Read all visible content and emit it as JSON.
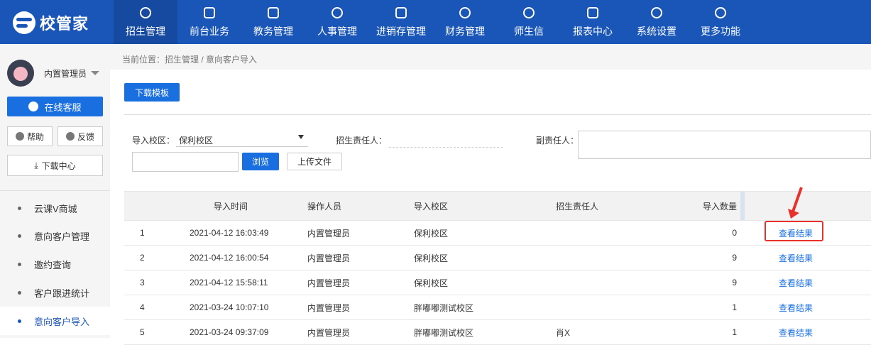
{
  "app": {
    "name": "校管家"
  },
  "nav": {
    "items": [
      {
        "label": "招生管理",
        "icon": "user-plus-icon",
        "active": true
      },
      {
        "label": "前台业务",
        "icon": "monitor-icon"
      },
      {
        "label": "教务管理",
        "icon": "book-icon"
      },
      {
        "label": "人事管理",
        "icon": "person-icon"
      },
      {
        "label": "进销存管理",
        "icon": "inbox-arrow-icon"
      },
      {
        "label": "财务管理",
        "icon": "yuan-icon"
      },
      {
        "label": "师生信",
        "icon": "chat-icon"
      },
      {
        "label": "报表中心",
        "icon": "bar-chart-icon"
      },
      {
        "label": "系统设置",
        "icon": "gear-icon"
      },
      {
        "label": "更多功能",
        "icon": "more-icon"
      }
    ]
  },
  "sidebar": {
    "username": "内置管理员",
    "online_service": "在线客服",
    "help": "帮助",
    "feedback": "反馈",
    "download_center": "下载中心",
    "items": [
      {
        "label": "云课V商城"
      },
      {
        "label": "意向客户管理"
      },
      {
        "label": "邀约查询"
      },
      {
        "label": "客户跟进统计"
      },
      {
        "label": "意向客户导入",
        "active": true
      }
    ]
  },
  "breadcrumb": "当前位置：招生管理 / 意向客户导入",
  "toolbar": {
    "download_template": "下载模板"
  },
  "form": {
    "campus_label": "导入校区：",
    "campus_value": "保利校区",
    "owner_label": "招生责任人：",
    "deputy_label": "副责任人：",
    "browse": "浏览",
    "upload": "上传文件"
  },
  "table": {
    "headers": [
      "导入时间",
      "操作人员",
      "导入校区",
      "招生责任人",
      "导入数量"
    ],
    "rows": [
      {
        "idx": "1",
        "time": "2021-04-12 16:03:49",
        "operator": "内置管理员",
        "campus": "保利校区",
        "owner": "",
        "count": "0",
        "action": "查看结果"
      },
      {
        "idx": "2",
        "time": "2021-04-12 16:00:54",
        "operator": "内置管理员",
        "campus": "保利校区",
        "owner": "",
        "count": "9",
        "action": "查看结果"
      },
      {
        "idx": "3",
        "time": "2021-04-12 15:58:11",
        "operator": "内置管理员",
        "campus": "保利校区",
        "owner": "",
        "count": "9",
        "action": "查看结果"
      },
      {
        "idx": "4",
        "time": "2021-03-24 10:07:10",
        "operator": "内置管理员",
        "campus": "胖嘟嘟测试校区",
        "owner": "",
        "count": "1",
        "action": "查看结果"
      },
      {
        "idx": "5",
        "time": "2021-03-24 09:37:09",
        "operator": "内置管理员",
        "campus": "胖嘟嘟测试校区",
        "owner": "肖X",
        "count": "1",
        "action": "查看结果"
      }
    ]
  },
  "colors": {
    "nav_bg": "#1a56b8",
    "primary": "#1a6fe0",
    "highlight": "#e8312a"
  }
}
